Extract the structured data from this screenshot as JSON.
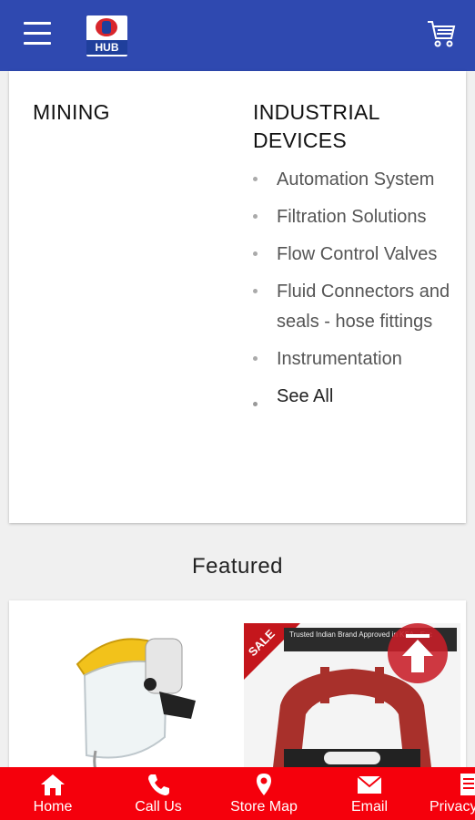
{
  "header": {
    "logo_text": "HUB",
    "menu_icon": "hamburger-menu-icon",
    "cart_icon": "shopping-cart-icon"
  },
  "menu": {
    "mining_title": "MINING",
    "industrial_title": "INDUSTRIAL DEVICES",
    "industrial_items": [
      "Automation System",
      "Filtration Solutions",
      "Flow Control Valves",
      "Fluid Connectors and seals - hose fittings",
      "Instrumentation",
      "See All"
    ]
  },
  "featured": {
    "title": "Featured",
    "products": [
      {
        "image": "face-shield-visor-image"
      },
      {
        "image": "danger-barrier-image",
        "ribbon": "SALE",
        "banner": "Trusted Indian Brand Approved in KSA - Exc"
      }
    ]
  },
  "scroll_top_icon": "arrow-up-icon",
  "bottom_nav": [
    {
      "label": "Home",
      "icon": "home-icon"
    },
    {
      "label": "Call Us",
      "icon": "phone-icon"
    },
    {
      "label": "Store Map",
      "icon": "map-pin-icon"
    },
    {
      "label": "Email",
      "icon": "envelope-icon"
    },
    {
      "label": "Privacy",
      "icon": "document-icon"
    }
  ],
  "colors": {
    "app_bar": "#2f49b0",
    "bottom_nav": "#f5000c",
    "sale_red": "#c4161c"
  }
}
